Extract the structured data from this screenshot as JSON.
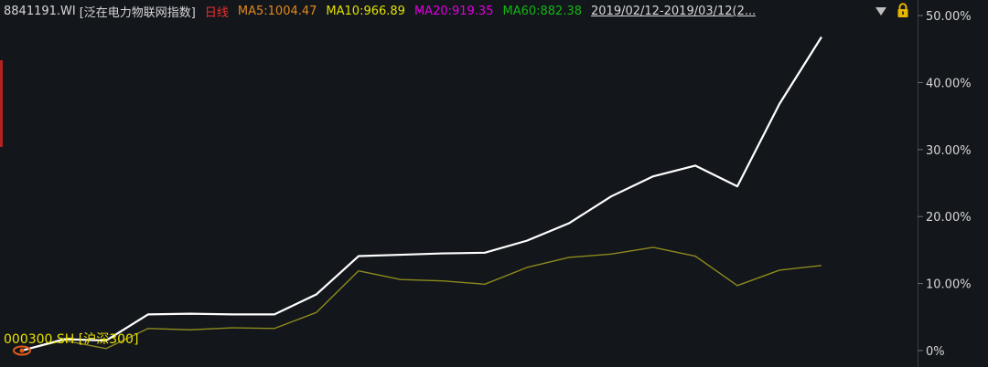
{
  "header": {
    "code": "8841191.WI",
    "name": "[泛在电力物联网指数]",
    "period": "日线",
    "ma5": "MA5:1004.47",
    "ma10": "MA10:966.89",
    "ma20": "MA20:919.35",
    "ma60": "MA60:882.38",
    "range": "2019/02/12-2019/03/12(2..."
  },
  "benchmark_label": "000300.SH [沪深300]",
  "colors": {
    "background": "#13161b",
    "main_series": "#ffffff",
    "benchmark_series": "#8c8a1e",
    "ma5": "#e08a1f",
    "ma10": "#e3e100",
    "ma20": "#e000e0",
    "ma60": "#13b613",
    "period": "#e83030"
  },
  "icons": [
    "chevron-down-icon",
    "lock-icon",
    "eye-marker-icon"
  ],
  "chart_data": {
    "type": "line",
    "x": [
      1,
      2,
      3,
      4,
      5,
      6,
      7,
      8,
      9,
      10,
      11,
      12,
      13,
      14,
      15,
      16,
      17,
      18,
      19,
      20,
      21,
      22,
      23
    ],
    "ylim": [
      0,
      50
    ],
    "yticks": [
      "50.00%",
      "40.00%",
      "30.00%",
      "20.00%",
      "10.00%",
      "0%"
    ],
    "ytick_values": [
      50,
      40,
      30,
      20,
      10,
      0
    ],
    "series": [
      {
        "values": [
          0,
          1.7,
          1.5,
          5.4,
          5.5,
          5.4,
          5.4,
          8.4,
          14.1,
          14.3,
          14.5,
          14.6,
          16.4,
          19.0,
          23.0,
          26.0,
          27.6,
          24.5,
          36.8,
          46.8
        ]
      },
      {
        "values": [
          0,
          1.5,
          0.3,
          3.3,
          3.1,
          3.4,
          3.3,
          5.7,
          11.9,
          10.6,
          10.4,
          9.9,
          12.4,
          13.9,
          14.4,
          15.4,
          14.1,
          9.7,
          12.0,
          12.7
        ]
      }
    ]
  }
}
